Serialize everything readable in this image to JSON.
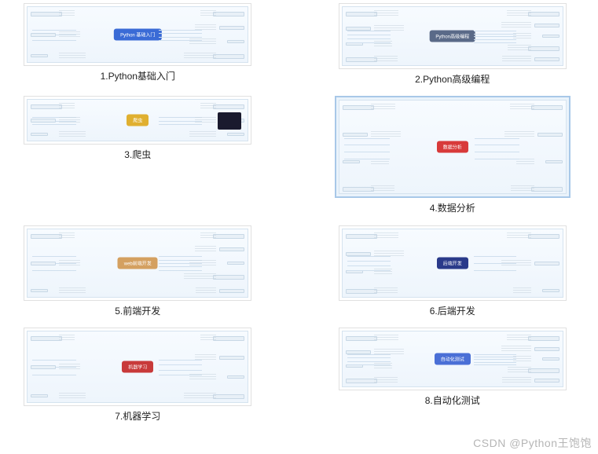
{
  "items": [
    {
      "caption": "1.Python基础入门",
      "center_label": "Python 基础入门",
      "center_bg": "#3a6bd6",
      "thumb_w": 290,
      "thumb_h": 80,
      "selected": false,
      "show_sidebox": false
    },
    {
      "caption": "2.Python高级编程",
      "center_label": "Python高级编程",
      "center_bg": "#5a6a88",
      "thumb_w": 290,
      "thumb_h": 84,
      "selected": false,
      "show_sidebox": false
    },
    {
      "caption": "3.爬虫",
      "center_label": "爬虫",
      "center_bg": "#e0b030",
      "thumb_w": 290,
      "thumb_h": 62,
      "selected": false,
      "show_sidebox": true
    },
    {
      "caption": "4.数据分析",
      "center_label": "数据分析",
      "center_bg": "#d83a3a",
      "thumb_w": 300,
      "thumb_h": 130,
      "selected": true,
      "show_sidebox": false
    },
    {
      "caption": "5.前端开发",
      "center_label": "web前端开发",
      "center_bg": "#d4a060",
      "thumb_w": 290,
      "thumb_h": 96,
      "selected": false,
      "show_sidebox": false
    },
    {
      "caption": "6.后端开发",
      "center_label": "后端开发",
      "center_bg": "#2a3a8a",
      "thumb_w": 290,
      "thumb_h": 96,
      "selected": false,
      "show_sidebox": false
    },
    {
      "caption": "7.机器学习",
      "center_label": "机器学习",
      "center_bg": "#c83a3a",
      "thumb_w": 290,
      "thumb_h": 100,
      "selected": false,
      "show_sidebox": false
    },
    {
      "caption": "8.自动化测试",
      "center_label": "自动化测试",
      "center_bg": "#4a6fd6",
      "thumb_w": 290,
      "thumb_h": 80,
      "selected": false,
      "show_sidebox": false
    }
  ],
  "watermark": "CSDN @Python王饱饱"
}
